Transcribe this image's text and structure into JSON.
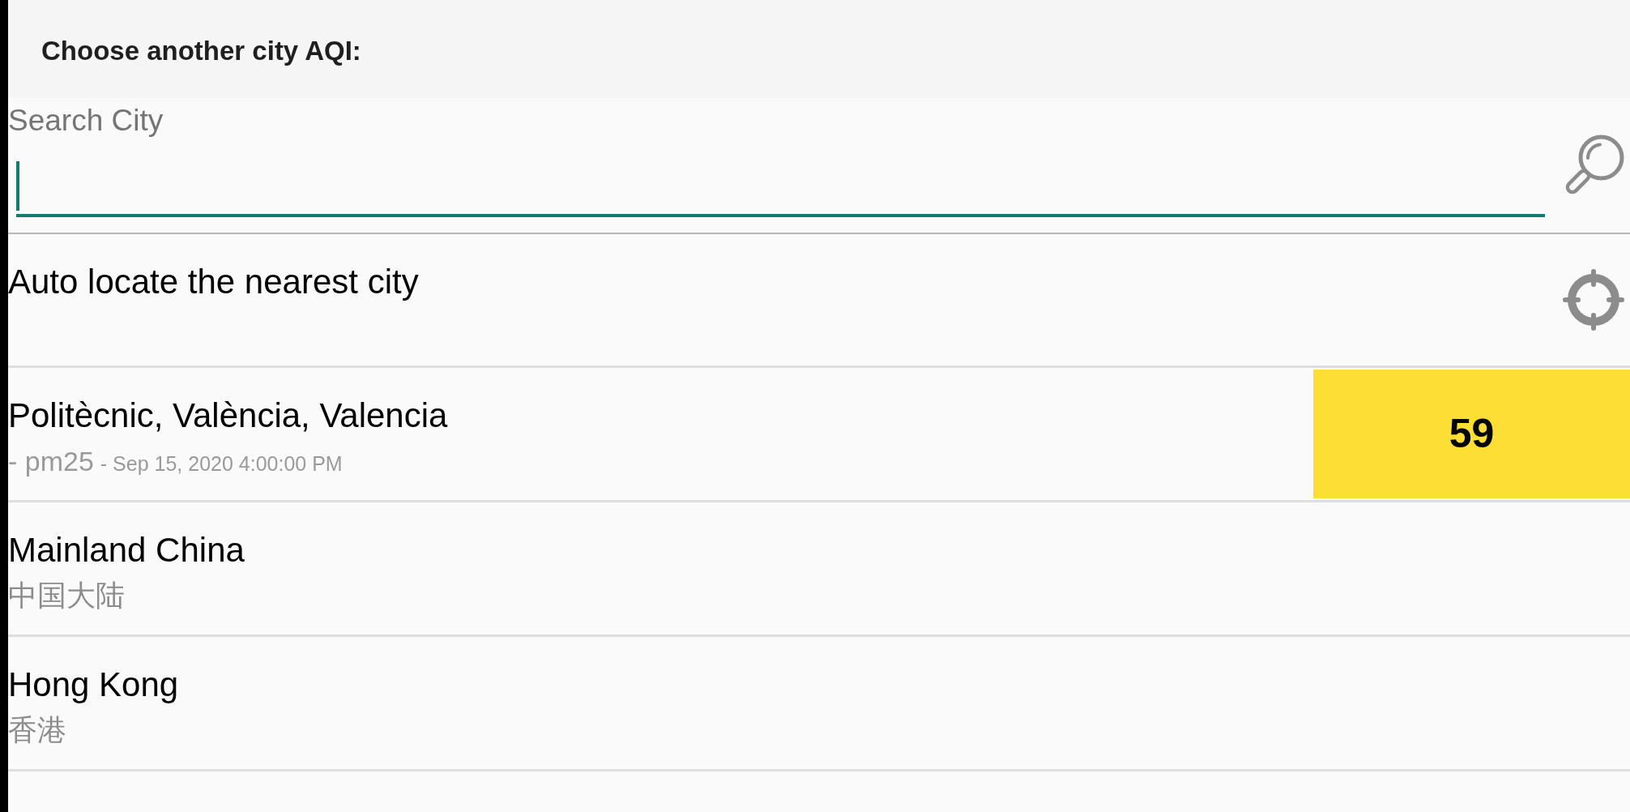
{
  "header": {
    "title": "Choose another city AQI:"
  },
  "search": {
    "label": "Search City",
    "focused": true
  },
  "auto_locate": {
    "label": "Auto locate the nearest city"
  },
  "cities": [
    {
      "kind": "station",
      "name": "Politècnic, València, Valencia",
      "pollutant": "- pm25",
      "time": "- Sep 15, 2020 4:00:00 PM",
      "aqi": "59",
      "color": "#fdde34"
    },
    {
      "kind": "region",
      "name": "Mainland China",
      "local_name": "中国大陆"
    },
    {
      "kind": "region",
      "name": "Hong Kong",
      "local_name": "香港"
    }
  ]
}
